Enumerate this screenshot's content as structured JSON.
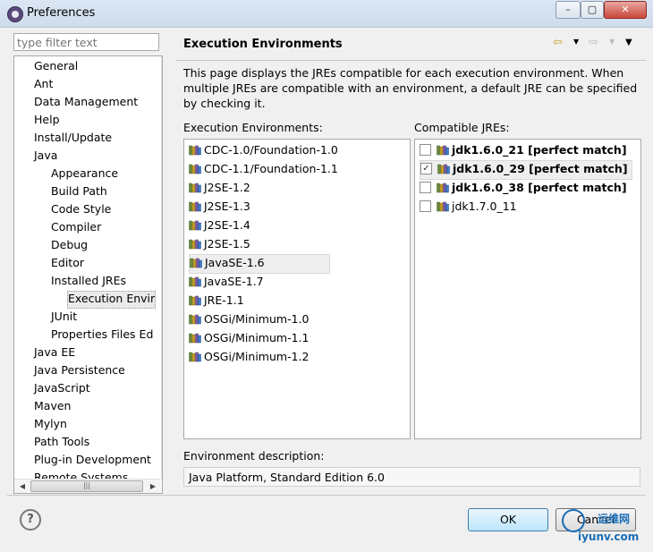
{
  "window": {
    "title": "Preferences",
    "controls": [
      "–",
      "▢",
      "✕"
    ]
  },
  "filter": {
    "placeholder": "type filter text"
  },
  "tree": [
    {
      "label": "General",
      "level": 0
    },
    {
      "label": "Ant",
      "level": 0
    },
    {
      "label": "Data Management",
      "level": 0
    },
    {
      "label": "Help",
      "level": 0
    },
    {
      "label": "Install/Update",
      "level": 0
    },
    {
      "label": "Java",
      "level": 0
    },
    {
      "label": "Appearance",
      "level": 1
    },
    {
      "label": "Build Path",
      "level": 1
    },
    {
      "label": "Code Style",
      "level": 1
    },
    {
      "label": "Compiler",
      "level": 1
    },
    {
      "label": "Debug",
      "level": 1
    },
    {
      "label": "Editor",
      "level": 1
    },
    {
      "label": "Installed JREs",
      "level": 1
    },
    {
      "label": "Execution Envir",
      "level": 2,
      "selected": true
    },
    {
      "label": "JUnit",
      "level": 1
    },
    {
      "label": "Properties Files Ed",
      "level": 1
    },
    {
      "label": "Java EE",
      "level": 0
    },
    {
      "label": "Java Persistence",
      "level": 0
    },
    {
      "label": "JavaScript",
      "level": 0
    },
    {
      "label": "Maven",
      "level": 0
    },
    {
      "label": "Mylyn",
      "level": 0
    },
    {
      "label": "Path Tools",
      "level": 0
    },
    {
      "label": "Plug-in Development",
      "level": 0
    },
    {
      "label": "Remote Systems",
      "level": 0
    }
  ],
  "page": {
    "heading": "Execution Environments",
    "description": "This page displays the JREs compatible for each execution environment. When multiple JREs are compatible with an environment, a default JRE can be specified by checking it.",
    "exec_label": "Execution Environments:",
    "compat_label": "Compatible JREs:",
    "env_desc_label": "Environment description:",
    "env_desc_value": "Java Platform, Standard Edition 6.0"
  },
  "environments": [
    {
      "label": "CDC-1.0/Foundation-1.0"
    },
    {
      "label": "CDC-1.1/Foundation-1.1"
    },
    {
      "label": "J2SE-1.2"
    },
    {
      "label": "J2SE-1.3"
    },
    {
      "label": "J2SE-1.4"
    },
    {
      "label": "J2SE-1.5"
    },
    {
      "label": "JavaSE-1.6",
      "selected": true
    },
    {
      "label": "JavaSE-1.7"
    },
    {
      "label": "JRE-1.1"
    },
    {
      "label": "OSGi/Minimum-1.0"
    },
    {
      "label": "OSGi/Minimum-1.1"
    },
    {
      "label": "OSGi/Minimum-1.2"
    }
  ],
  "jres": [
    {
      "label": "jdk1.6.0_21 [perfect match]",
      "checked": false,
      "bold": true
    },
    {
      "label": "jdk1.6.0_29 [perfect match]",
      "checked": true,
      "bold": true,
      "selected": true
    },
    {
      "label": "jdk1.6.0_38 [perfect match]",
      "checked": false,
      "bold": true
    },
    {
      "label": "jdk1.7.0_11",
      "checked": false,
      "bold": false
    }
  ],
  "buttons": {
    "help": "?",
    "ok": "OK",
    "cancel": "Cancel"
  },
  "watermark": {
    "line1": "运维网",
    "line2": "iyunv.com"
  }
}
